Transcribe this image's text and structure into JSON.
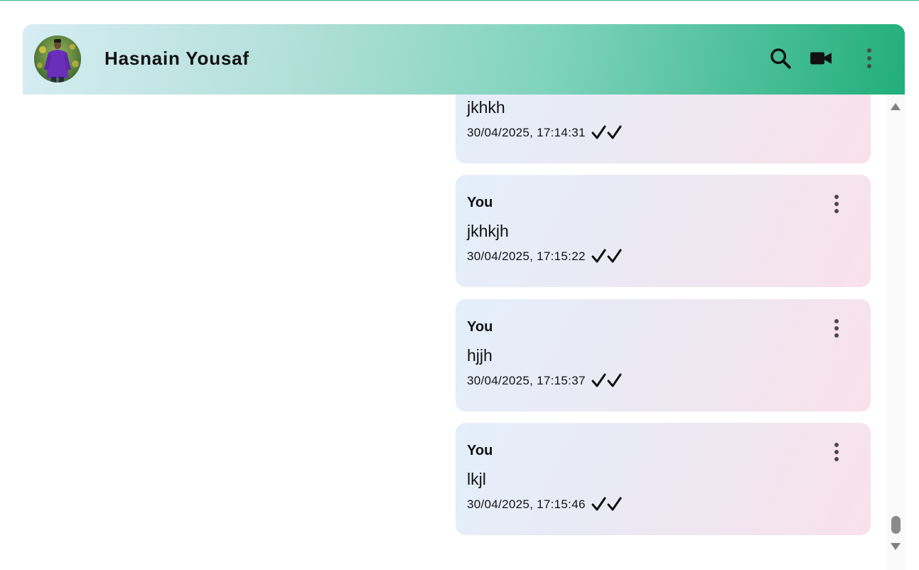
{
  "header": {
    "contact_name": "Hasnain Yousaf",
    "avatar_alt": "Hasnain Yousaf",
    "icons": [
      "search-icon",
      "video-call-icon",
      "more-vert-icon"
    ]
  },
  "messages": [
    {
      "sender": "",
      "text": "jkhkh",
      "timestamp": "30/04/2025, 17:14:31",
      "status": "read",
      "has_menu": false
    },
    {
      "sender": "You",
      "text": "jkhkjh",
      "timestamp": "30/04/2025, 17:15:22",
      "status": "read",
      "has_menu": true
    },
    {
      "sender": "You",
      "text": "hjjh",
      "timestamp": "30/04/2025, 17:15:37",
      "status": "read",
      "has_menu": true
    },
    {
      "sender": "You",
      "text": "lkjl",
      "timestamp": "30/04/2025, 17:15:46",
      "status": "read",
      "has_menu": true
    }
  ],
  "colors": {
    "header_gradient_start": "#d6edf3",
    "header_gradient_end": "#22ae7c",
    "bubble_gradient_start": "#e3effb",
    "bubble_gradient_end": "#f9e1ea",
    "top_rule": "#2fb38a"
  }
}
